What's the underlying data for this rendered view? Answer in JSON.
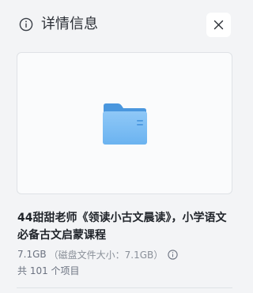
{
  "header": {
    "title": "详情信息",
    "info_icon": "info-circle-icon",
    "close_icon": "close-icon"
  },
  "preview": {
    "icon": "folder-icon"
  },
  "item": {
    "name": "44甜甜老师《领读小古文晨读》，小学语文必备古文启蒙课程",
    "size": "7.1GB",
    "disk_size": "（磁盘文件大小：7.1GB）",
    "size_info_icon": "info-circle-icon",
    "count": "共 101 个项目"
  },
  "colors": {
    "background": "#f3f4f6",
    "folder": "#5aa6e8",
    "text": "#1f2329",
    "muted": "#6b7280"
  }
}
